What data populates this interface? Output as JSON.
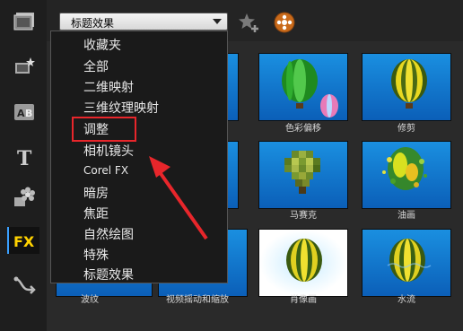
{
  "effect_dropdown": {
    "selected": "标题效果"
  },
  "menu": {
    "items": [
      {
        "label": "收藏夹"
      },
      {
        "label": "全部"
      },
      {
        "label": "二维映射"
      },
      {
        "label": "三维纹理映射"
      },
      {
        "label": "调整"
      },
      {
        "label": "相机镜头"
      },
      {
        "label": "Corel FX"
      },
      {
        "label": "暗房"
      },
      {
        "label": "焦距"
      },
      {
        "label": "自然绘图"
      },
      {
        "label": "特殊"
      },
      {
        "label": "标题效果"
      }
    ],
    "highlighted": "调整"
  },
  "thumbnails": [
    {
      "caption": "色彩偏移",
      "icon": "balloon-green"
    },
    {
      "caption": "修剪",
      "icon": "balloon-yellow-striped"
    },
    {
      "caption": "马赛克",
      "icon": "balloon-pixelated"
    },
    {
      "caption": "油画",
      "icon": "balloon-oil-paint"
    },
    {
      "caption": "波纹",
      "icon": "balloon"
    },
    {
      "caption": "视频摇动和缩放",
      "icon": "balloon"
    },
    {
      "caption": "肖像画",
      "icon": "balloon-vignette"
    },
    {
      "caption": "水流",
      "icon": "balloon-water"
    }
  ],
  "sidebar": {
    "items": [
      "media-library-icon",
      "instant-project-icon",
      "transition-icon",
      "title-icon",
      "graphics-icon",
      "filter-icon",
      "path-icon"
    ],
    "active": "filter-icon"
  },
  "accent_colors": {
    "highlight_box": "#e8262b",
    "active_tab": "#3aa0ff",
    "fx_text": "#ffd200"
  }
}
